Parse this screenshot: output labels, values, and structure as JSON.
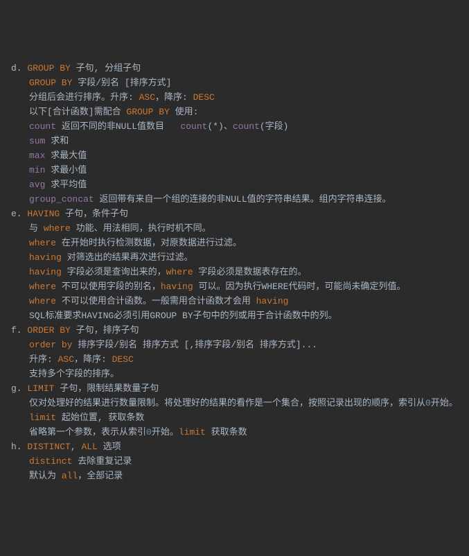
{
  "lines": [
    {
      "cls": "ln",
      "segs": [
        {
          "t": "d. "
        },
        {
          "t": "GROUP BY",
          "c": "kw"
        },
        {
          "t": " 子句, 分组子句"
        }
      ]
    },
    {
      "cls": "i1",
      "segs": [
        {
          "t": "GROUP BY",
          "c": "kw"
        },
        {
          "t": " 字段/别名 [排序方式]"
        }
      ]
    },
    {
      "cls": "i1",
      "segs": [
        {
          "t": "分组后会进行排序。升序: "
        },
        {
          "t": "ASC",
          "c": "kw"
        },
        {
          "t": "，降序: "
        },
        {
          "t": "DESC",
          "c": "kw"
        }
      ]
    },
    {
      "cls": "i1",
      "segs": [
        {
          "t": "以下[合计函数]需配合 "
        },
        {
          "t": "GROUP BY",
          "c": "kw"
        },
        {
          "t": " 使用:"
        }
      ]
    },
    {
      "cls": "i1",
      "segs": [
        {
          "t": "count",
          "c": "fn"
        },
        {
          "t": " 返回不同的非NULL值数目   "
        },
        {
          "t": "count",
          "c": "fn"
        },
        {
          "t": "(*)、"
        },
        {
          "t": "count",
          "c": "fn"
        },
        {
          "t": "(字段)"
        }
      ]
    },
    {
      "cls": "i1",
      "segs": [
        {
          "t": "sum",
          "c": "fn"
        },
        {
          "t": " 求和"
        }
      ]
    },
    {
      "cls": "i1",
      "segs": [
        {
          "t": "max",
          "c": "fn"
        },
        {
          "t": " 求最大值"
        }
      ]
    },
    {
      "cls": "i1",
      "segs": [
        {
          "t": "min",
          "c": "fn"
        },
        {
          "t": " 求最小值"
        }
      ]
    },
    {
      "cls": "i1",
      "segs": [
        {
          "t": "avg",
          "c": "fn"
        },
        {
          "t": " 求平均值"
        }
      ]
    },
    {
      "cls": "i1",
      "segs": [
        {
          "t": "group_concat",
          "c": "fn"
        },
        {
          "t": " 返回带有来自一个组的连接的非NULL值的字符串结果。组内字符串连接。"
        }
      ]
    },
    {
      "cls": "ln",
      "segs": [
        {
          "t": "e. "
        },
        {
          "t": "HAVING",
          "c": "kw"
        },
        {
          "t": " 子句，条件子句"
        }
      ]
    },
    {
      "cls": "i1",
      "segs": [
        {
          "t": "与 "
        },
        {
          "t": "where",
          "c": "kw"
        },
        {
          "t": " 功能、用法相同，执行时机不同。"
        }
      ]
    },
    {
      "cls": "i1",
      "segs": [
        {
          "t": "where",
          "c": "kw"
        },
        {
          "t": " 在开始时执行检测数据，对原数据进行过滤。"
        }
      ]
    },
    {
      "cls": "i1",
      "segs": [
        {
          "t": "having",
          "c": "kw"
        },
        {
          "t": " 对筛选出的结果再次进行过滤。"
        }
      ]
    },
    {
      "cls": "i1",
      "segs": [
        {
          "t": "having",
          "c": "kw"
        },
        {
          "t": " 字段必须是查询出来的，"
        },
        {
          "t": "where",
          "c": "kw"
        },
        {
          "t": " 字段必须是数据表存在的。"
        }
      ]
    },
    {
      "cls": "i1",
      "segs": [
        {
          "t": "where",
          "c": "kw"
        },
        {
          "t": " 不可以使用字段的别名，"
        },
        {
          "t": "having",
          "c": "kw"
        },
        {
          "t": " 可以。因为执行WHERE代码时，可能尚未确定列值。"
        }
      ]
    },
    {
      "cls": "i1",
      "segs": [
        {
          "t": "where",
          "c": "kw"
        },
        {
          "t": " 不可以使用合计函数。一般需用合计函数才会用 "
        },
        {
          "t": "having",
          "c": "kw"
        }
      ]
    },
    {
      "cls": "i1",
      "segs": [
        {
          "t": "SQL标准要求HAVING必须引用GROUP BY子句中的列或用于合计函数中的列。"
        }
      ]
    },
    {
      "cls": "ln",
      "segs": [
        {
          "t": "f. "
        },
        {
          "t": "ORDER BY",
          "c": "kw"
        },
        {
          "t": " 子句，排序子句"
        }
      ]
    },
    {
      "cls": "i1",
      "segs": [
        {
          "t": "order",
          "c": "kw"
        },
        {
          "t": " "
        },
        {
          "t": "by",
          "c": "kw"
        },
        {
          "t": " 排序字段/别名 排序方式 [,排序字段/别名 排序方式]..."
        }
      ]
    },
    {
      "cls": "i1",
      "segs": [
        {
          "t": "升序: "
        },
        {
          "t": "ASC",
          "c": "kw"
        },
        {
          "t": "，降序: "
        },
        {
          "t": "DESC",
          "c": "kw"
        }
      ]
    },
    {
      "cls": "i1",
      "segs": [
        {
          "t": "支持多个字段的排序。"
        }
      ]
    },
    {
      "cls": "ln",
      "segs": [
        {
          "t": "g. "
        },
        {
          "t": "LIMIT",
          "c": "kw"
        },
        {
          "t": " 子句，限制结果数量子句"
        }
      ]
    },
    {
      "cls": "i1",
      "segs": [
        {
          "t": "仅对处理好的结果进行数量限制。将处理好的结果的看作是一个集合，按照记录出现的顺序，索引从"
        },
        {
          "t": "0",
          "c": "num"
        },
        {
          "t": "开始。"
        }
      ]
    },
    {
      "cls": "i1",
      "segs": [
        {
          "t": "limit",
          "c": "kw"
        },
        {
          "t": " 起始位置, 获取条数"
        }
      ]
    },
    {
      "cls": "i1",
      "segs": [
        {
          "t": "省略第一个参数，表示从索引"
        },
        {
          "t": "0",
          "c": "num"
        },
        {
          "t": "开始。"
        },
        {
          "t": "limit",
          "c": "kw"
        },
        {
          "t": " 获取条数"
        }
      ]
    },
    {
      "cls": "ln",
      "segs": [
        {
          "t": "h. "
        },
        {
          "t": "DISTINCT",
          "c": "kw"
        },
        {
          "t": ", "
        },
        {
          "t": "ALL",
          "c": "kw"
        },
        {
          "t": " 选项"
        }
      ]
    },
    {
      "cls": "i1",
      "segs": [
        {
          "t": "distinct",
          "c": "kw"
        },
        {
          "t": " 去除重复记录"
        }
      ]
    },
    {
      "cls": "i1",
      "segs": [
        {
          "t": "默认为 "
        },
        {
          "t": "all",
          "c": "kw"
        },
        {
          "t": "，全部记录"
        }
      ]
    }
  ]
}
